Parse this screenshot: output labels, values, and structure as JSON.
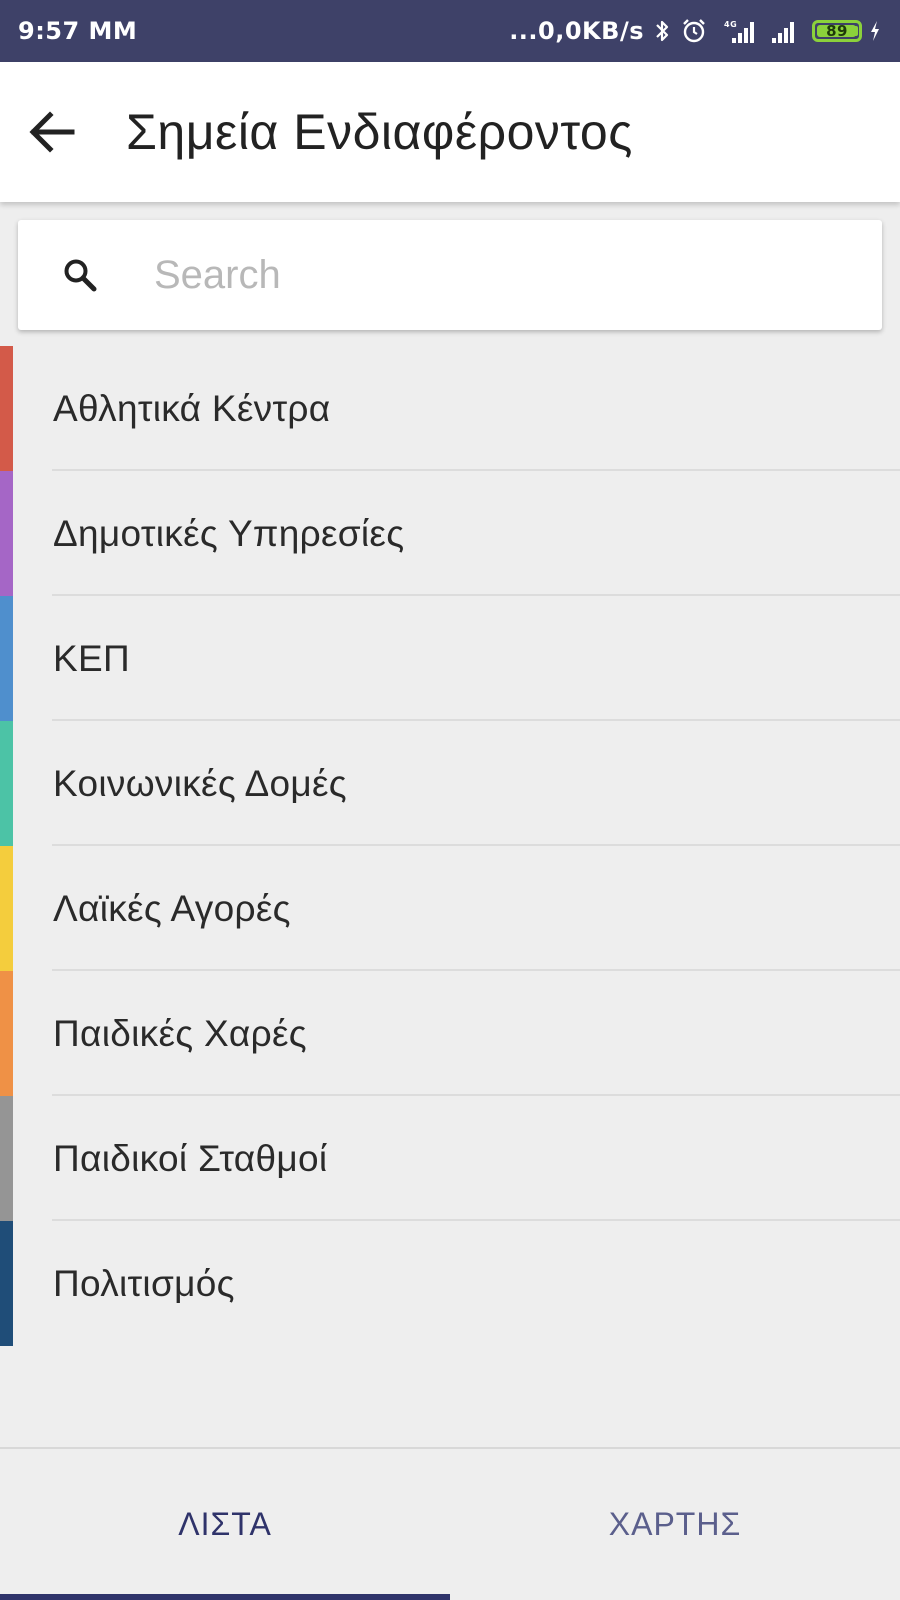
{
  "status_bar": {
    "time": "9:57 MM",
    "network_speed": "...0,0KB/s",
    "battery_level": "89",
    "icons": [
      "bluetooth-icon",
      "alarm-icon",
      "signal-icon",
      "signal-icon",
      "battery-icon",
      "charging-icon"
    ]
  },
  "app_bar": {
    "title": "Σημεία Ενδιαφέροντος",
    "back_icon": "arrow-left-icon"
  },
  "search": {
    "placeholder": "Search",
    "value": "",
    "icon": "search-icon"
  },
  "categories": [
    {
      "label": "Αθλητικά Κέντρα",
      "color": "#d35a49"
    },
    {
      "label": "Δημοτικές Υπηρεσίες",
      "color": "#a566c6"
    },
    {
      "label": "ΚΕΠ",
      "color": "#4f8fcd"
    },
    {
      "label": "Κοινωνικές Δομές",
      "color": "#4cc3a6"
    },
    {
      "label": "Λαϊκές Αγορές",
      "color": "#f4cd3d"
    },
    {
      "label": "Παιδικές Χαρές",
      "color": "#ef9146"
    },
    {
      "label": "Παιδικοί Σταθμοί",
      "color": "#959595"
    },
    {
      "label": "Πολιτισμός",
      "color": "#1f4d78"
    }
  ],
  "tabs": [
    {
      "label": "ΛΙΣΤΑ",
      "selected": true
    },
    {
      "label": "ΧΑΡΤΗΣ",
      "selected": false
    }
  ],
  "colors": {
    "status_bar": "#3e4168",
    "accent": "#2f336a",
    "background": "#eeeeee"
  }
}
